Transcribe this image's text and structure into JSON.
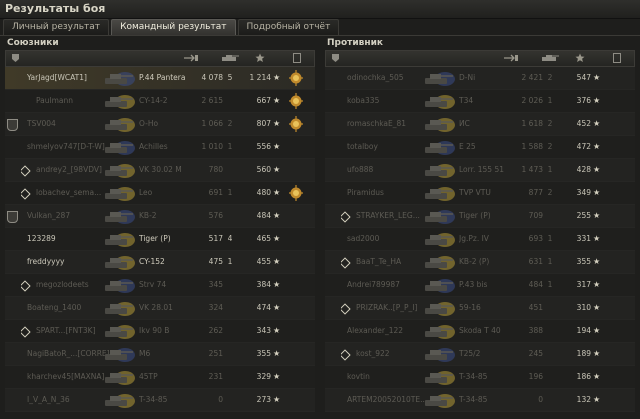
{
  "window": {
    "title": "Результаты боя"
  },
  "tabs": [
    {
      "label": "Личный результат",
      "active": false
    },
    {
      "label": "Командный результат",
      "active": true
    },
    {
      "label": "Подробный отчёт",
      "active": false
    }
  ],
  "allies": {
    "title": "Союзники",
    "rows": [
      {
        "name": "YarJagd[WCAT1]",
        "tank": "P.44 Pantera",
        "damage": "4 078",
        "kills": "5",
        "xp": "1 214",
        "medal": true,
        "self": true,
        "alive": true
      },
      {
        "name": "Paulmann",
        "tank": "CY-14-2",
        "damage": "2 615",
        "kills": "",
        "xp": "667",
        "medal": true,
        "indent": true,
        "icon": "tank",
        "alive": false
      },
      {
        "name": "TSV004",
        "tank": "O-Ho",
        "damage": "1 066",
        "kills": "2",
        "xp": "807",
        "medal": true,
        "platoon": true,
        "alive": false
      },
      {
        "name": "shmelyov747[D-T-W]",
        "tank": "Achilles",
        "damage": "1 010",
        "kills": "1",
        "xp": "556",
        "alive": false
      },
      {
        "name": "andrey2_[98VDV]",
        "tank": "VK 30.02 M",
        "damage": "780",
        "kills": "",
        "xp": "560",
        "squad": true,
        "alive": false
      },
      {
        "name": "lobachev_sema...",
        "tank": "Leo",
        "damage": "691",
        "kills": "1",
        "xp": "480",
        "medal": true,
        "squad": true,
        "alive": false
      },
      {
        "name": "Vulkan_287",
        "tank": "KB-2",
        "damage": "576",
        "kills": "",
        "xp": "484",
        "platoon": true,
        "alive": false
      },
      {
        "name": "123289",
        "tank": "Tiger (P)",
        "damage": "517",
        "kills": "4",
        "xp": "465",
        "alive": true
      },
      {
        "name": "freddyyyy",
        "tank": "CY-152",
        "damage": "475",
        "kills": "1",
        "xp": "455",
        "alive": true
      },
      {
        "name": "megozlodeets",
        "tank": "Strv 74",
        "damage": "345",
        "kills": "",
        "xp": "384",
        "squad": true,
        "alive": false
      },
      {
        "name": "Boateng_1400",
        "tank": "VK 28.01",
        "damage": "324",
        "kills": "",
        "xp": "474",
        "alive": false
      },
      {
        "name": "SPART...[FNT3K]",
        "tank": "Ikv 90 B",
        "damage": "262",
        "kills": "",
        "xp": "343",
        "squad": true,
        "alive": false
      },
      {
        "name": "NagiBatoR_...[CORRE]",
        "tank": "M6",
        "damage": "251",
        "kills": "",
        "xp": "355",
        "alive": false
      },
      {
        "name": "kharchev45[MAXNA]",
        "tank": "45TP",
        "damage": "231",
        "kills": "",
        "xp": "329",
        "alive": false
      },
      {
        "name": "I_V_A_N_36",
        "tank": "T-34-85",
        "damage": "0",
        "kills": "",
        "xp": "273",
        "alive": false
      }
    ]
  },
  "enemies": {
    "title": "Противник",
    "rows": [
      {
        "name": "odinochka_505",
        "tank": "D-Ni",
        "damage": "2 421",
        "kills": "2",
        "xp": "547",
        "alive": false
      },
      {
        "name": "koba335",
        "tank": "T34",
        "damage": "2 026",
        "kills": "1",
        "xp": "376",
        "alive": false
      },
      {
        "name": "romaschkaE_81",
        "tank": "ИС",
        "damage": "1 618",
        "kills": "2",
        "xp": "452",
        "alive": false
      },
      {
        "name": "totalboy",
        "tank": "E 25",
        "damage": "1 588",
        "kills": "2",
        "xp": "472",
        "alive": false
      },
      {
        "name": "ufo888",
        "tank": "Lorr. 155 51",
        "damage": "1 473",
        "kills": "1",
        "xp": "428",
        "alive": false
      },
      {
        "name": "Piramidus",
        "tank": "TVP VTU",
        "damage": "877",
        "kills": "2",
        "xp": "349",
        "alive": false
      },
      {
        "name": "STRAYKER_LEG...",
        "tank": "Tiger (P)",
        "damage": "709",
        "kills": "",
        "xp": "255",
        "squad": true,
        "alive": false
      },
      {
        "name": "sad2000",
        "tank": "Jg.Pz. IV",
        "damage": "693",
        "kills": "1",
        "xp": "331",
        "alive": false
      },
      {
        "name": "BaaT_Te_HA",
        "tank": "KB-2 (P)",
        "damage": "631",
        "kills": "1",
        "xp": "355",
        "squad": true,
        "alive": false
      },
      {
        "name": "Andrei789987",
        "tank": "P.43 bis",
        "damage": "484",
        "kills": "1",
        "xp": "317",
        "alive": false
      },
      {
        "name": "PRIZRAK..[P_P_I]",
        "tank": "59-16",
        "damage": "451",
        "kills": "",
        "xp": "310",
        "squad": true,
        "alive": false
      },
      {
        "name": "Alexander_122",
        "tank": "Skoda T 40",
        "damage": "388",
        "kills": "",
        "xp": "194",
        "alive": false
      },
      {
        "name": "kost_922",
        "tank": "T25/2",
        "damage": "245",
        "kills": "",
        "xp": "189",
        "squad": true,
        "alive": false
      },
      {
        "name": "kovtin",
        "tank": "T-34-85",
        "damage": "196",
        "kills": "",
        "xp": "186",
        "alive": false
      },
      {
        "name": "ARTEM20052010TE...",
        "tank": "T-34-85",
        "damage": "0",
        "kills": "",
        "xp": "132",
        "alive": false
      }
    ]
  },
  "columns": {
    "star_glyph": "★"
  },
  "colors": {
    "self_row": "#403a28",
    "accent": "#d5d1c0",
    "tank_blue": "#3a4c86",
    "tank_yellow": "#b59a38"
  }
}
